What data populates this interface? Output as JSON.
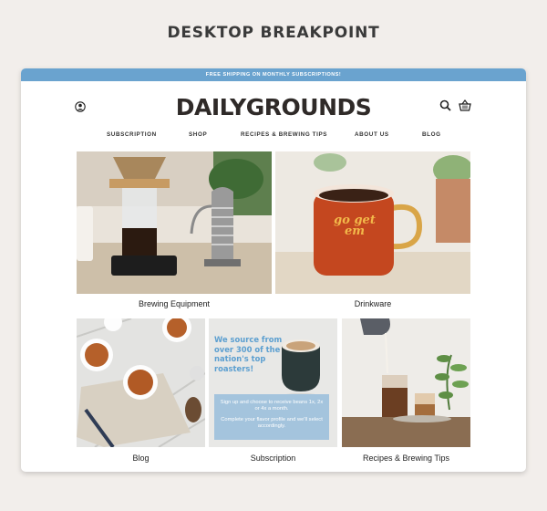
{
  "heading": "DESKTOP BREAKPOINT",
  "promo": {
    "text": "FREE SHIPPING ON MONTHLY SUBSCRIPTIONS!"
  },
  "header": {
    "logo": "DAILYGROUNDS",
    "icons": {
      "account": "account-icon",
      "search": "search-icon",
      "cart": "basket-icon"
    }
  },
  "nav": {
    "items": [
      "SUBSCRIPTION",
      "SHOP",
      "RECIPES & BREWING TIPS",
      "ABOUT US",
      "BLOG"
    ]
  },
  "tiles": {
    "brewing": {
      "label": "Brewing Equipment"
    },
    "drinkware": {
      "label": "Drinkware",
      "mug_text": "go get em"
    },
    "blog": {
      "label": "Blog"
    },
    "subscription": {
      "label": "Subscription",
      "headline": "We source from over 300 of the nation's top roasters!",
      "line1": "Sign up and choose to receive beans 1x, 2x or 4x a month.",
      "line2": "Complete your flavor profile and we'll select accordingly."
    },
    "recipes": {
      "label": "Recipes & Brewing Tips"
    }
  },
  "colors": {
    "promo_bar": "#6aa3cf",
    "sub_headline": "#5c9fd0",
    "sub_box": "#a4c4dd",
    "mug": "#c4471f",
    "mug_text": "#f2b84a"
  }
}
